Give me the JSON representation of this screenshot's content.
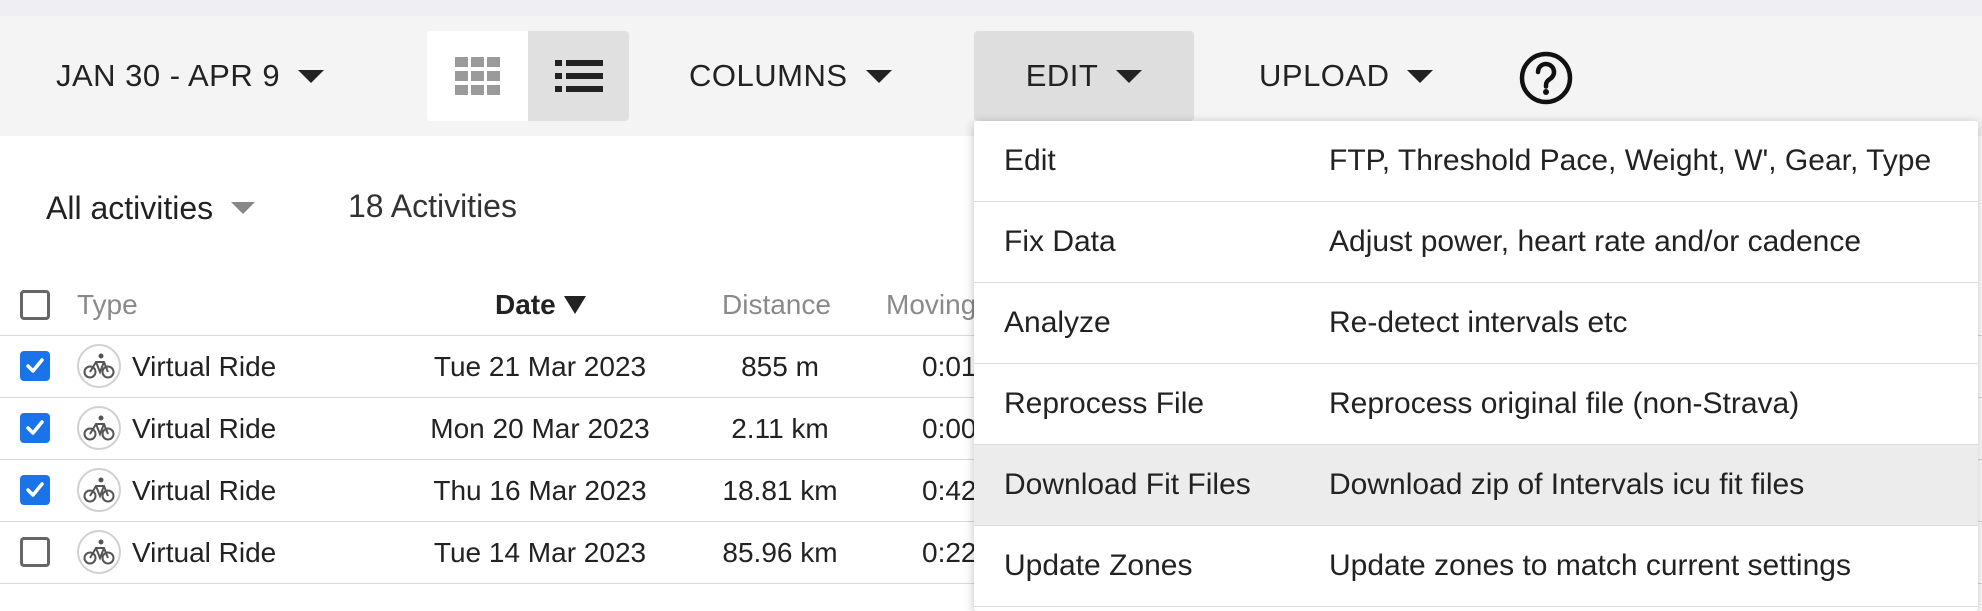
{
  "toolbar": {
    "date_range": "JAN 30 - APR 9",
    "columns_label": "COLUMNS",
    "edit_label": "EDIT",
    "upload_label": "UPLOAD"
  },
  "filter": {
    "label": "All activities",
    "count": "18 Activities"
  },
  "table": {
    "headers": {
      "type": "Type",
      "date": "Date",
      "distance": "Distance",
      "moving": "Moving"
    },
    "rows": [
      {
        "checked": true,
        "type": "Virtual Ride",
        "date": "Tue 21 Mar 2023",
        "distance": "855 m",
        "moving": "0:01"
      },
      {
        "checked": true,
        "type": "Virtual Ride",
        "date": "Mon 20 Mar 2023",
        "distance": "2.11 km",
        "moving": "0:00"
      },
      {
        "checked": true,
        "type": "Virtual Ride",
        "date": "Thu 16 Mar 2023",
        "distance": "18.81 km",
        "moving": "0:42"
      },
      {
        "checked": false,
        "type": "Virtual Ride",
        "date": "Tue 14 Mar 2023",
        "distance": "85.96 km",
        "moving": "0:22"
      }
    ]
  },
  "edit_menu": {
    "items": [
      {
        "label": "Edit",
        "description": "FTP, Threshold Pace, Weight, W', Gear, Type"
      },
      {
        "label": "Fix Data",
        "description": "Adjust power, heart rate and/or cadence"
      },
      {
        "label": "Analyze",
        "description": "Re-detect intervals etc"
      },
      {
        "label": "Reprocess File",
        "description": "Reprocess original file (non-Strava)"
      },
      {
        "label": "Download Fit Files",
        "description": "Download zip of Intervals icu fit files"
      },
      {
        "label": "Update Zones",
        "description": "Update zones to match current settings"
      }
    ],
    "highlighted_index": 4
  },
  "colors": {
    "accent": "#1a73e8",
    "toolbar_bg": "#f4f4f4",
    "menu_highlight": "#ececec"
  },
  "icons": {
    "grid_view": "grid-view-icon",
    "list_view": "list-view-icon",
    "help": "help-icon",
    "activity_type": "bicycle-icon",
    "checkbox": "checkbox-icon"
  }
}
